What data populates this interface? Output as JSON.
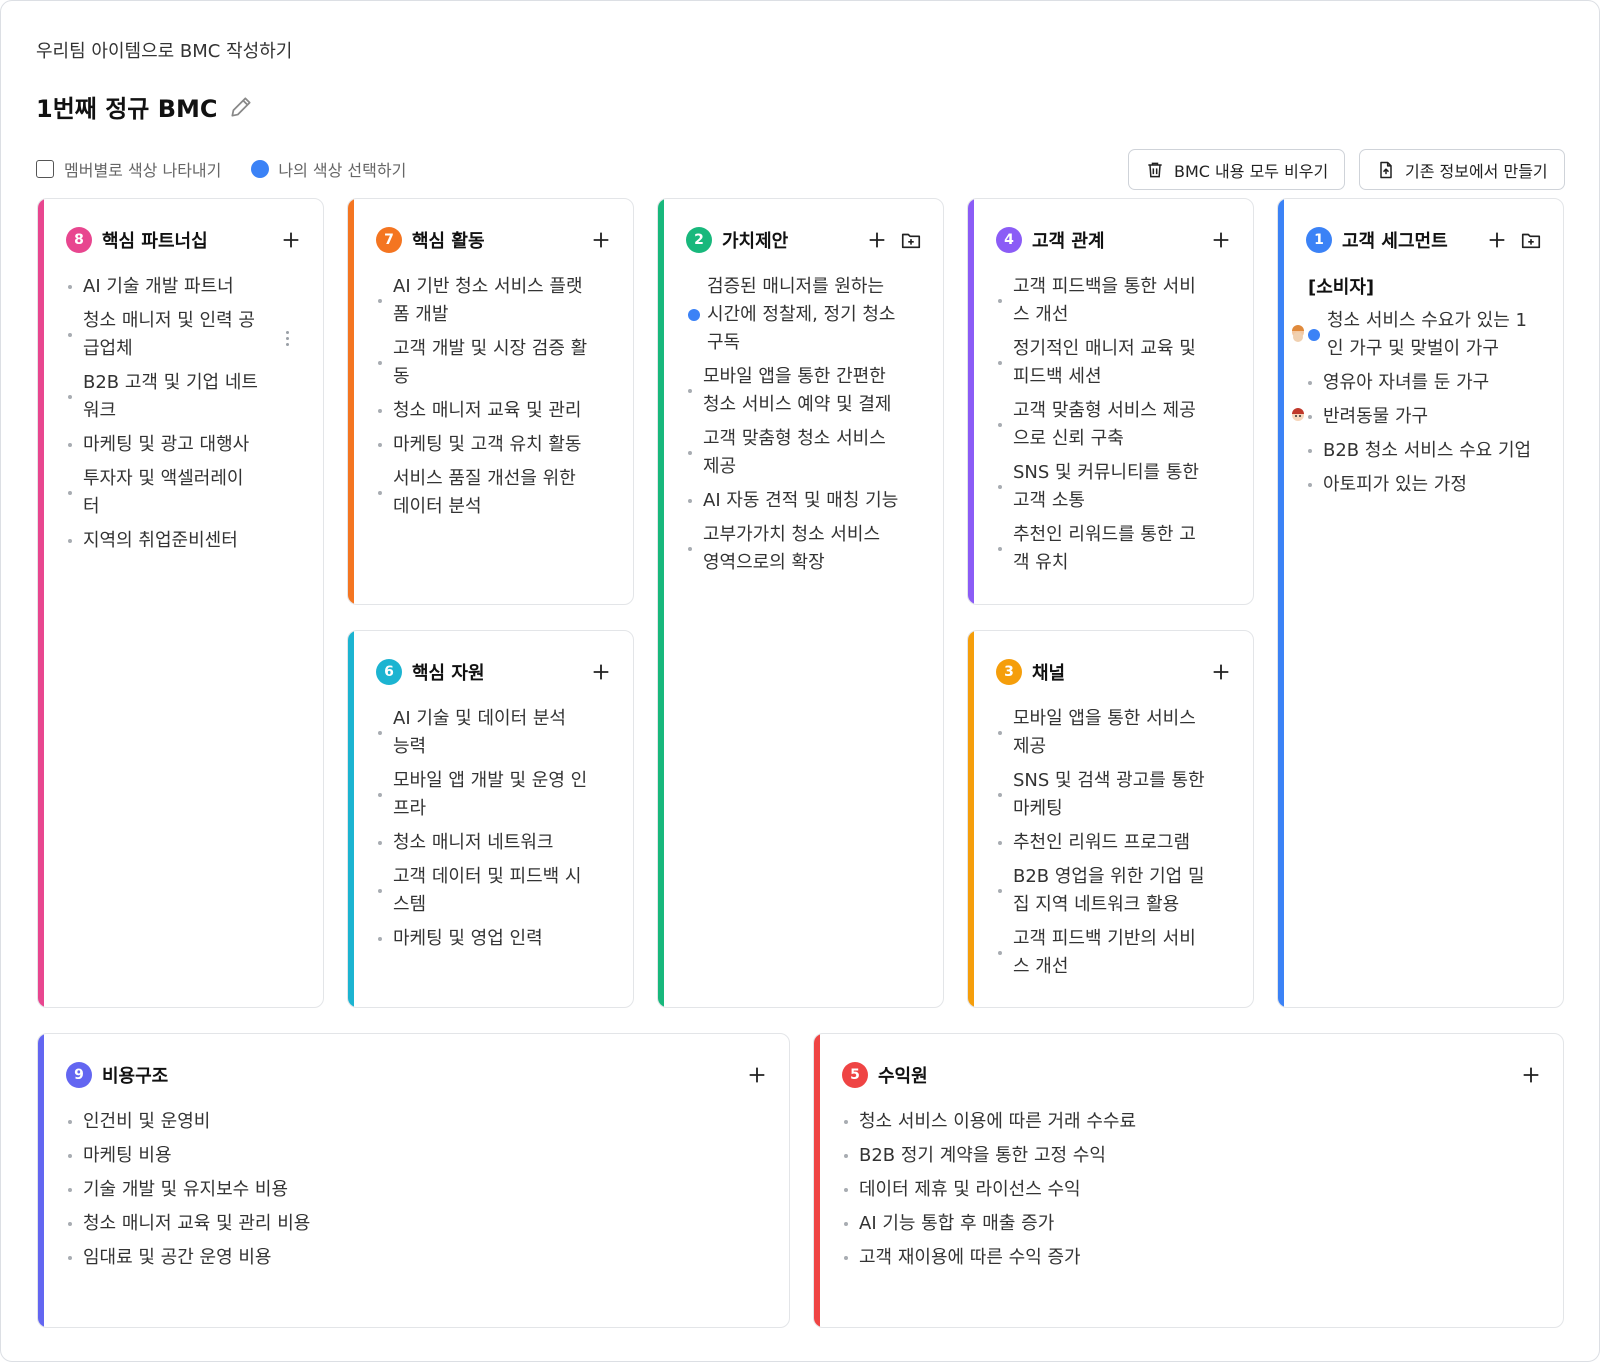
{
  "page": {
    "subtitle": "우리팀 아이템으로 BMC 작성하기",
    "title": "1번째 정규 BMC"
  },
  "options": {
    "member_color_label": "멤버별로 색상 나타내기",
    "my_color_label": "나의 색상 선택하기",
    "my_color": "#3b82f6"
  },
  "toolbar": {
    "clear_label": "BMC 내용 모두 비우기",
    "import_label": "기존 정보에서 만들기"
  },
  "colors": {
    "partners": "#e8468f",
    "activities": "#f47521",
    "value": "#18b87c",
    "relations": "#8b5cf6",
    "segments": "#3b82f6",
    "resources": "#1cb4d1",
    "channels": "#f59e0b",
    "costs": "#6366f1",
    "revenue": "#ef4444"
  },
  "blocks": {
    "partners": {
      "number": "8",
      "title": "핵심 파트너십",
      "items": [
        "AI 기술 개발 파트너",
        "청소 매니저 및 인력 공급업체",
        "B2B 고객 및 기업 네트워크",
        "마케팅 및 광고 대행사",
        "투자자 및 액셀러레이터",
        "지역의 취업준비센터"
      ]
    },
    "activities": {
      "number": "7",
      "title": "핵심 활동",
      "items": [
        "AI 기반 청소 서비스 플랫폼 개발",
        "고객 개발 및 시장 검증 활동",
        "청소 매니저 교육 및 관리",
        "마케팅 및 고객 유치 활동",
        "서비스 품질 개선을 위한 데이터 분석"
      ]
    },
    "resources": {
      "number": "6",
      "title": "핵심 자원",
      "items": [
        "AI 기술 및 데이터 분석 능력",
        "모바일 앱 개발 및 운영 인프라",
        "청소 매니저 네트워크",
        "고객 데이터 및 피드백 시스템",
        "마케팅 및 영업 인력"
      ]
    },
    "value": {
      "number": "2",
      "title": "가치제안",
      "items": [
        "검증된 매니저를 원하는 시간에 정찰제, 정기 청소 구독",
        "모바일 앱을 통한 간편한 청소 서비스 예약 및 결제",
        "고객 맞춤형 청소 서비스 제공",
        "AI 자동 견적 및 매칭 기능",
        "고부가가치 청소 서비스 영역으로의 확장"
      ]
    },
    "relations": {
      "number": "4",
      "title": "고객 관계",
      "items": [
        "고객 피드백을 통한 서비스 개선",
        "정기적인 매니저 교육 및 피드백 세션",
        "고객 맞춤형 서비스 제공으로 신뢰 구축",
        "SNS 및 커뮤니티를 통한 고객 소통",
        "추천인 리워드를 통한 고객 유치"
      ]
    },
    "channels": {
      "number": "3",
      "title": "채널",
      "items": [
        "모바일 앱을 통한 서비스 제공",
        "SNS 및 검색 광고를 통한 마케팅",
        "추천인 리워드 프로그램",
        "B2B 영업을 위한 기업 밀집 지역 네트워크 활용",
        "고객 피드백 기반의 서비스 개선"
      ]
    },
    "segments": {
      "number": "1",
      "title": "고객 세그먼트",
      "section": "[소비자]",
      "items": [
        "청소 서비스 수요가 있는 1인 가구 및 맞벌이 가구",
        "영유아 자녀를 둔 가구",
        "반려동물 가구",
        "B2B 청소 서비스 수요 기업",
        "아토피가 있는 가정"
      ]
    },
    "costs": {
      "number": "9",
      "title": "비용구조",
      "items": [
        "인건비 및 운영비",
        "마케팅 비용",
        "기술 개발 및 유지보수 비용",
        "청소 매니저 교육 및 관리 비용",
        "임대료 및 공간 운영 비용"
      ]
    },
    "revenue": {
      "number": "5",
      "title": "수익원",
      "items": [
        "청소 서비스 이용에 따른 거래 수수료",
        "B2B 정기 계약을 통한 고정 수익",
        "데이터 제휴 및 라이선스 수익",
        "AI 기능 통합 후 매출 증가",
        "고객 재이용에 따른 수익 증가"
      ]
    }
  }
}
